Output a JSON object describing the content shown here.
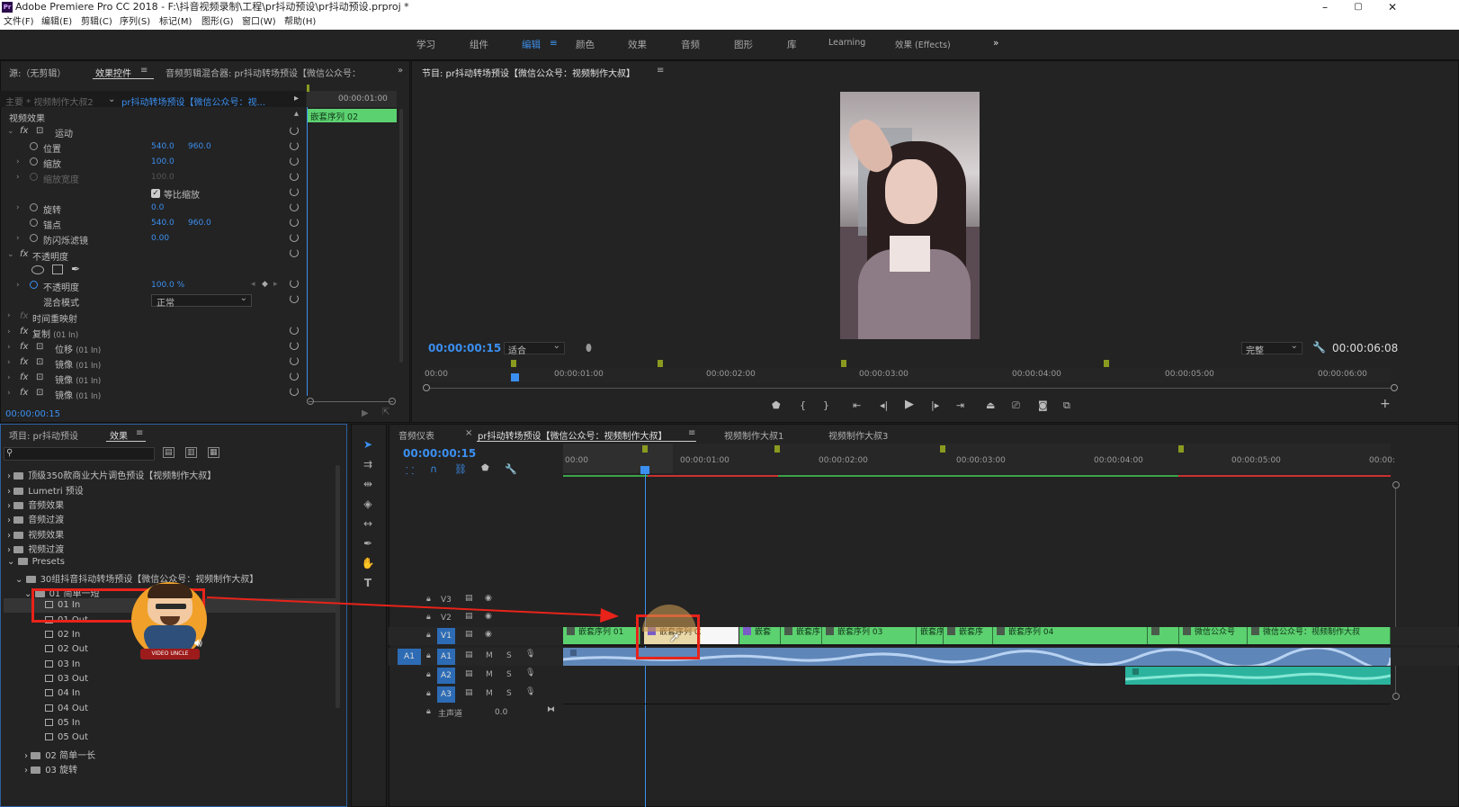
{
  "app": {
    "title": "Adobe Premiere Pro CC 2018 - F:\\抖音视频录制\\工程\\pr抖动预设\\pr抖动预设.prproj *",
    "logo": "Pr",
    "win_min": "–",
    "win_max": "▢",
    "win_close": "✕"
  },
  "menu": [
    "文件(F)",
    "编辑(E)",
    "剪辑(C)",
    "序列(S)",
    "标记(M)",
    "图形(G)",
    "窗口(W)",
    "帮助(H)"
  ],
  "workspaces": {
    "items": [
      "学习",
      "组件",
      "编辑",
      "颜色",
      "效果",
      "音频",
      "图形",
      "库",
      "Learning",
      "效果 (Effects)"
    ],
    "active": "编辑",
    "more": "»"
  },
  "effect_controls": {
    "tab_source": "源:（无剪辑）",
    "tab_effects": "效果控件",
    "tab_audio": "音频剪辑混合器: pr抖动转场预设【微信公众号：",
    "master": "主要 * 视频制作大叔2",
    "clip": "pr抖动转场预设【微信公众号：视...",
    "time_label": "00:00:01:00",
    "clip_bar": "嵌套序列 02",
    "video_effects": "视频效果",
    "motion": "运动",
    "position": {
      "label": "位置",
      "x": "540.0",
      "y": "960.0"
    },
    "scale": {
      "label": "缩放",
      "value": "100.0"
    },
    "scale_width": {
      "label": "缩放宽度",
      "value": "100.0"
    },
    "uniform_scale": "等比缩放",
    "rotation": {
      "label": "旋转",
      "value": "0.0"
    },
    "anchor": {
      "label": "锚点",
      "x": "540.0",
      "y": "960.0"
    },
    "flicker": {
      "label": "防闪烁滤镜",
      "value": "0.00"
    },
    "opacity_group": "不透明度",
    "opacity": {
      "label": "不透明度",
      "value": "100.0 %"
    },
    "blend": {
      "label": "混合模式",
      "value": "正常"
    },
    "time_remap": "时间重映射",
    "copy": "复制",
    "copy_suffix": "(01 In)",
    "offset": "位移",
    "offset_suffix": "(01 In)",
    "mirrors": [
      {
        "label": "镜像",
        "suffix": "(01 In)"
      },
      {
        "label": "镜像",
        "suffix": "(01 In)"
      },
      {
        "label": "镜像",
        "suffix": "(01 In)"
      }
    ],
    "timecode": "00:00:00:15"
  },
  "program": {
    "title": "节目: pr抖动转场预设【微信公众号：视频制作大叔】",
    "timecode": "00:00:00:15",
    "fit": "适合",
    "quality": "完整",
    "duration": "00:00:06:08",
    "ruler": [
      "00:00",
      "00:00:01:00",
      "00:00:02:00",
      "00:00:03:00",
      "00:00:04:00",
      "00:00:05:00",
      "00:00:06:00"
    ],
    "add": "+"
  },
  "project": {
    "tab_project": "项目: pr抖动预设",
    "tab_effects": "效果",
    "search_placeholder": "",
    "tree": [
      "顶级350款商业大片调色预设【视频制作大叔】",
      "Lumetri 预设",
      "音频效果",
      "音频过渡",
      "视频效果",
      "视频过渡",
      "Presets",
      "30组抖音抖动转场预设【微信公众号：视频制作大叔】",
      "01 简单一短"
    ],
    "presets": [
      "01 In",
      "01 Out",
      "02 In",
      "02 Out",
      "03 In",
      "03 Out",
      "04 In",
      "04 Out",
      "05 In",
      "05 Out"
    ],
    "folders_after": [
      "02 简单一长",
      "03 旋转"
    ]
  },
  "timeline": {
    "tab_meter": "音频仪表",
    "tab_seq": "pr抖动转场预设【微信公众号：视频制作大叔】",
    "tab_2": "视频制作大叔1",
    "tab_3": "视频制作大叔3",
    "timecode": "00:00:00:15",
    "ruler": [
      "00:00",
      "00:00:01:00",
      "00:00:02:00",
      "00:00:03:00",
      "00:00:04:00",
      "00:00:05:00",
      "00:00:"
    ],
    "tracks": [
      "V3",
      "V2",
      "V1",
      "A1",
      "A2",
      "A3"
    ],
    "source_a1": "A1",
    "master": {
      "label": "主声道",
      "value": "0.0"
    },
    "clips": [
      "嵌套序列 01",
      "嵌套序列 02",
      "嵌套",
      "嵌套序",
      "嵌套序列 03",
      "嵌套序列",
      "嵌套序",
      "嵌套序列 04",
      "",
      "微信公众号",
      "微信公众号：视频制作大叔"
    ],
    "track_buttons": {
      "m": "M",
      "s": "S"
    }
  },
  "colors": {
    "accent": "#3b8ff0",
    "clip_green": "#5cd170",
    "audio_blue": "#5f86b8",
    "audio_teal": "#2bb39e",
    "annotation_red": "#e8231a"
  },
  "avatar_text": "VIDEO UNCLE"
}
